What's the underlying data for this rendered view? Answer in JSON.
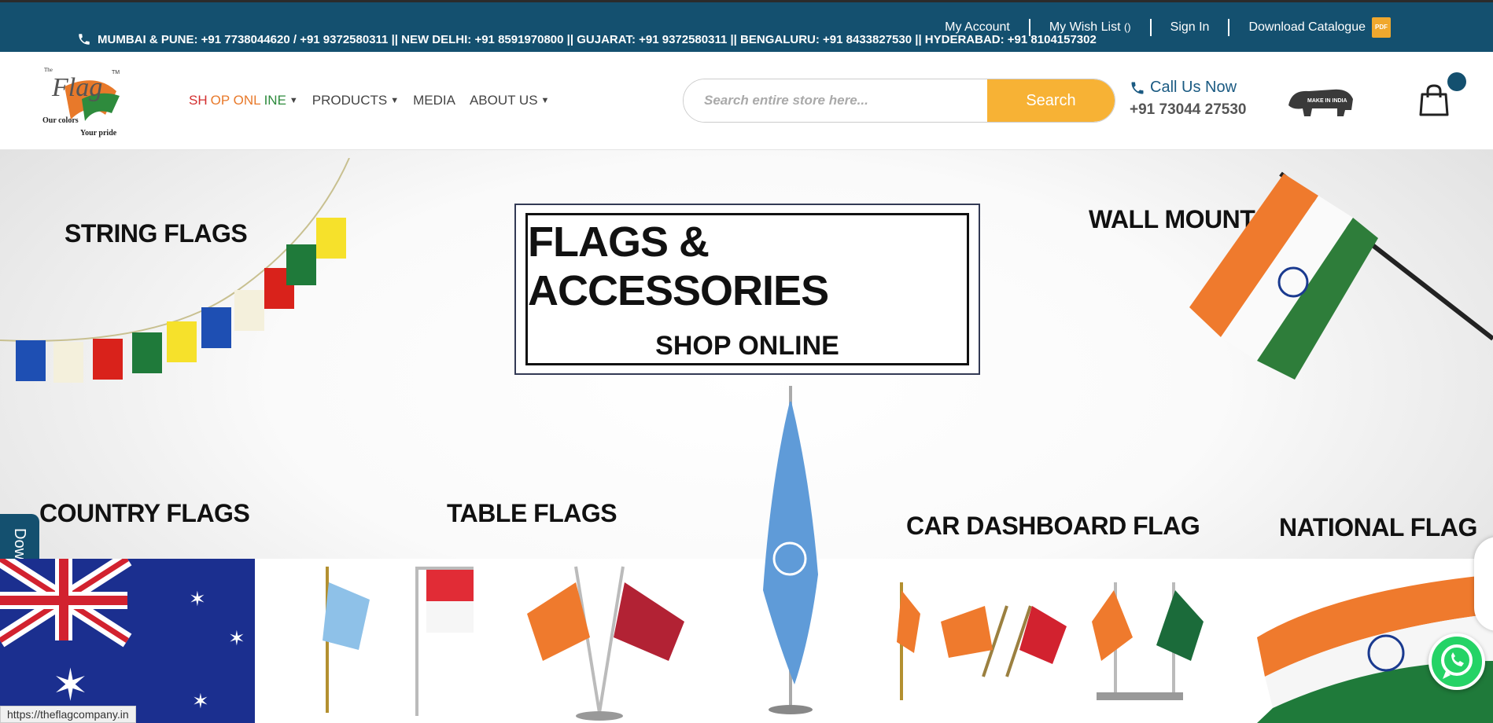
{
  "topbar": {
    "phones": "MUMBAI & PUNE: +91 7738044620 / +91 9372580311 || NEW DELHI: +91 8591970800 || GUJARAT: +91 9372580311 || BENGALURU: +91 8433827530 || HYDERABAD: +91 8104157302",
    "links": {
      "my_account": "My Account",
      "wish_list": "My Wish List",
      "wish_count": "()",
      "sign_in": "Sign In",
      "download_catalogue": "Download Catalogue",
      "pdf_badge": "PDF"
    }
  },
  "header": {
    "logo_text": "Flag",
    "logo_tag_left": "Our colors",
    "logo_tag_right": "Your pride",
    "logo_small": "The",
    "logo_tm": "TM",
    "nav": {
      "shop_online_parts": [
        "SH",
        "OP ONL",
        "INE"
      ],
      "products": "PRODUCTS",
      "media": "MEDIA",
      "about_us": "ABOUT US"
    },
    "search": {
      "placeholder": "Search entire store here...",
      "button": "Search"
    },
    "call": {
      "label": "Call Us Now",
      "number": "+91 73044 27530"
    },
    "make_in_india": "MAKE IN INDIA"
  },
  "hero": {
    "banner_title": "FLAGS & ACCESSORIES",
    "banner_sub": "SHOP ONLINE",
    "categories": {
      "string_flags": "STRING FLAGS",
      "wall_mount": "WALL MOUNT",
      "country_flags": "COUNTRY FLAGS",
      "table_flags": "TABLE FLAGS",
      "car_dashboard_flag": "CAR DASHBOARD FLAG",
      "national_flag": "NATIONAL FLAG"
    }
  },
  "side_tab": "Download Catalogue",
  "status_url": "https://theflagcompany.in",
  "colors": {
    "brand_blue": "#14506f",
    "search_orange": "#f7b235",
    "whatsapp": "#25d366"
  }
}
